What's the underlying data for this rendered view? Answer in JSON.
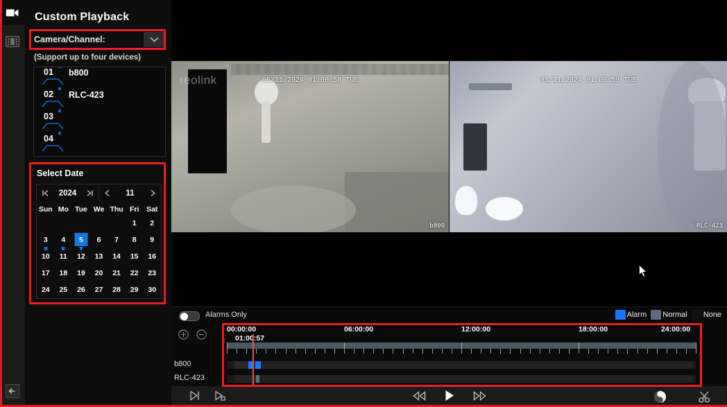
{
  "app": {
    "title": "Custom Playback",
    "accent_blue": "#1677e0",
    "highlight_red": "#f01c1c",
    "playhead_red": "#e4564f"
  },
  "rail": {
    "items": [
      {
        "name": "live-view-icon",
        "label": "Live View"
      },
      {
        "name": "playback-icon",
        "label": "Playback"
      }
    ],
    "back_label": "Back"
  },
  "sidebar": {
    "camera_channel": {
      "label": "Camera/Channel:",
      "caret": "chevron-down-icon",
      "hint": "(Support up to four devices)"
    },
    "devices": [
      {
        "slot": "01",
        "name": "b800"
      },
      {
        "slot": "02",
        "name": "RLC-423"
      },
      {
        "slot": "03",
        "name": ""
      },
      {
        "slot": "04",
        "name": ""
      }
    ],
    "select_date": {
      "title": "Select Date",
      "year": "2024",
      "month": "11",
      "prev_year_icon": "first-page-icon",
      "next_year_icon": "last-page-icon",
      "prev_month_icon": "chevron-left-icon",
      "next_month_icon": "chevron-right-icon",
      "weekdays": [
        "Sun",
        "Mo",
        "Tue",
        "We",
        "Thu",
        "Fri",
        "Sat"
      ],
      "leading_blanks": 5,
      "days": [
        1,
        2,
        3,
        4,
        5,
        6,
        7,
        8,
        9,
        10,
        11,
        12,
        13,
        14,
        15,
        16,
        17,
        18,
        19,
        20,
        21,
        22,
        23,
        24,
        25,
        26,
        27,
        28,
        29,
        30
      ],
      "selected_day": 5,
      "days_with_recordings": [
        3,
        4,
        5
      ]
    }
  },
  "video": {
    "watermark": "reolink",
    "panes": [
      {
        "timestamp": "05/11/2024 01:00:58 TUE",
        "camera": "b800"
      },
      {
        "timestamp": "05/11/2024 01:00:59 TUE",
        "camera": "RLC-423"
      }
    ]
  },
  "timeline": {
    "alarms_only_label": "Alarms Only",
    "alarms_only_on": false,
    "legend": [
      {
        "label": "Alarm",
        "color": "#1677ff"
      },
      {
        "label": "Normal",
        "color": "#5f6b80"
      },
      {
        "label": "None",
        "color": "#111111"
      }
    ],
    "zoom_in_icon": "plus-circle-icon",
    "zoom_out_icon": "minus-circle-icon",
    "ruler_labels": [
      "00:00:00",
      "06:00:00",
      "12:00:00",
      "18:00:00",
      "24:00:00"
    ],
    "current_time": "01:00:57",
    "tracks": [
      {
        "name": "b800",
        "segments": [
          {
            "start_pct": 1.6,
            "width_pct": 3.0,
            "color": "#2a2a2a"
          },
          {
            "start_pct": 4.6,
            "width_pct": 1.0,
            "color": "#1677ff"
          },
          {
            "start_pct": 5.6,
            "width_pct": 0.5,
            "color": "#2a2a2a"
          },
          {
            "start_pct": 6.1,
            "width_pct": 1.1,
            "color": "#1677ff"
          },
          {
            "start_pct": 7.2,
            "width_pct": 92.0,
            "color": "#222222"
          }
        ]
      },
      {
        "name": "RLC-423",
        "segments": [
          {
            "start_pct": 1.6,
            "width_pct": 4.6,
            "color": "#242424"
          },
          {
            "start_pct": 6.2,
            "width_pct": 0.8,
            "color": "#5f6b80"
          },
          {
            "start_pct": 7.0,
            "width_pct": 92.2,
            "color": "#222222"
          }
        ]
      }
    ]
  },
  "controls": {
    "left": [
      {
        "name": "step-frame-button",
        "icon": "step-forward-icon"
      },
      {
        "name": "snapshot-button",
        "icon": "frame-capture-icon"
      }
    ],
    "center": [
      {
        "name": "rewind-button",
        "icon": "rewind-icon"
      },
      {
        "name": "play-button",
        "icon": "play-icon"
      },
      {
        "name": "fast-forward-button",
        "icon": "fast-forward-icon"
      }
    ],
    "right": [
      {
        "name": "contrast-button",
        "icon": "contrast-circle-icon"
      },
      {
        "name": "clip-button",
        "icon": "scissors-icon"
      }
    ]
  }
}
